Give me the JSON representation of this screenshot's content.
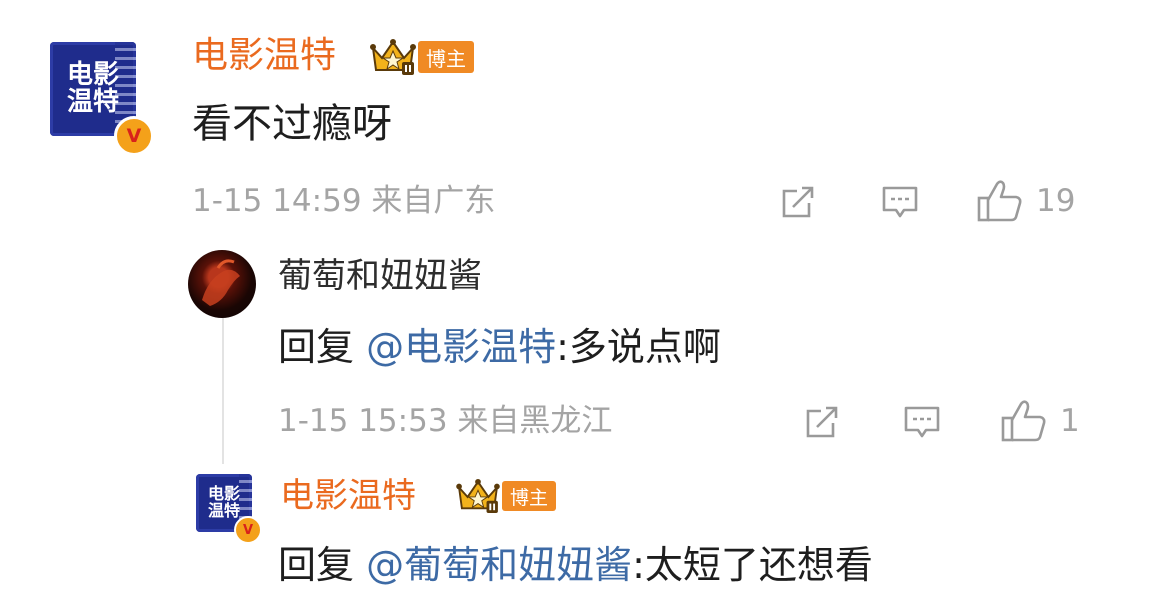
{
  "comment": {
    "avatar_text": "电影温特",
    "username": "电影温特",
    "badge_label": "博主",
    "text": "看不过瘾呀",
    "meta": "1-15 14:59 来自广东",
    "likes": "19",
    "verified_mark": "V"
  },
  "replies": [
    {
      "username": "葡萄和妞妞酱",
      "reply_prefix": "回复",
      "mention": "@电影温特",
      "text": ":多说点啊",
      "meta": "1-15 15:53 来自黑龙江",
      "likes": "1"
    },
    {
      "avatar_text": "电影温特",
      "username": "电影温特",
      "badge_label": "博主",
      "reply_prefix": "回复",
      "mention": "@葡萄和妞妞酱",
      "text": ":太短了还想看",
      "verified_mark": "V"
    }
  ],
  "icons": {
    "share": "share-icon",
    "comment": "comment-icon",
    "like": "thumbs-up-icon",
    "crown": "crown-icon"
  },
  "colors": {
    "username": "#ea6a1f",
    "mention": "#3d6aa5",
    "meta": "#a4a4a4",
    "badge": "#f08a24",
    "brand_avatar": "#1f2c8c"
  }
}
